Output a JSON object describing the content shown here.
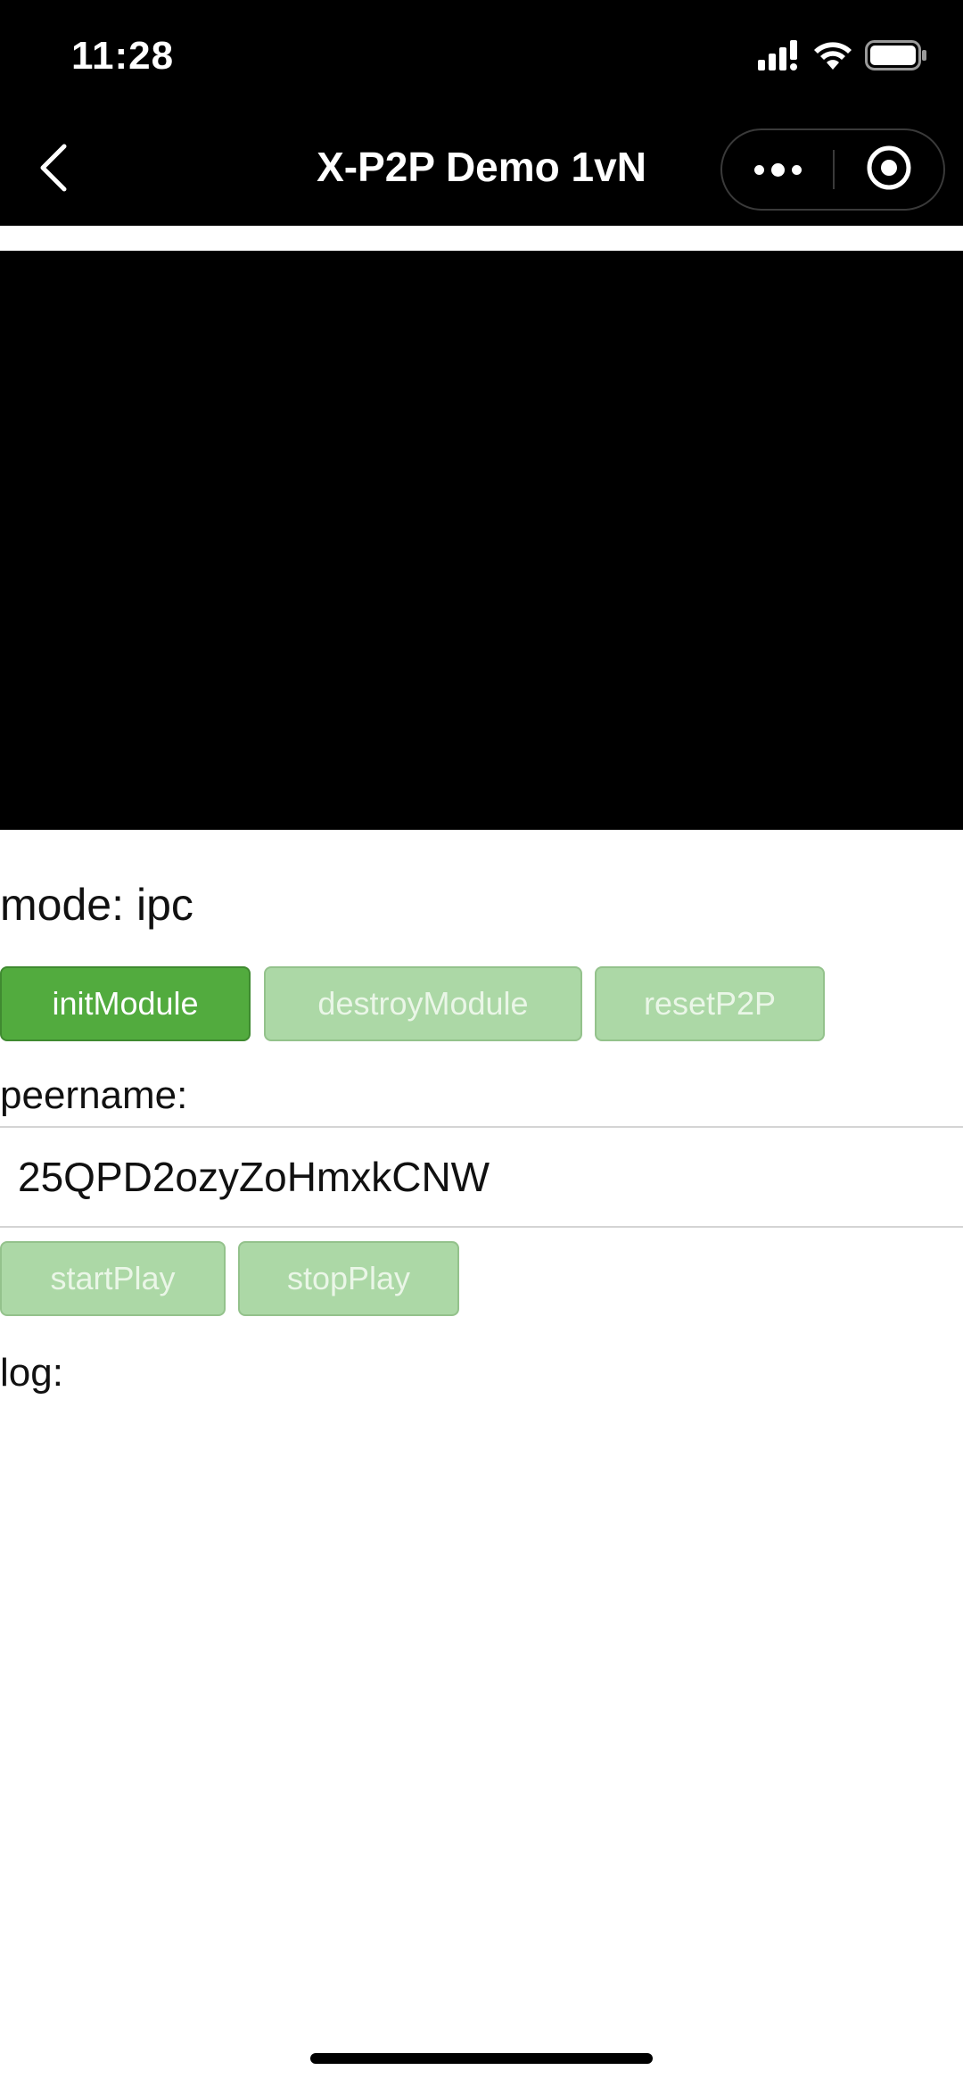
{
  "status_bar": {
    "time": "11:28",
    "icons": [
      "cellular-signal-icon",
      "wifi-icon",
      "battery-icon"
    ]
  },
  "nav": {
    "back_icon": "chevron-left-icon",
    "title": "X-P2P Demo 1vN",
    "more_icon": "more-dots-icon",
    "close_icon": "record-target-icon"
  },
  "mode": {
    "label": "mode:",
    "value": "ipc"
  },
  "module_buttons": {
    "init": "initModule",
    "destroy": "destroyModule",
    "reset": "resetP2P"
  },
  "peername": {
    "label": "peername:",
    "value": "25QPD2ozyZoHmxkCNW"
  },
  "play_buttons": {
    "start": "startPlay",
    "stop": "stopPlay"
  },
  "log": {
    "label": "log:",
    "content": ""
  },
  "colors": {
    "primary_green": "#52ab3e",
    "disabled_green": "#acd8a6",
    "header_bg": "#000000"
  }
}
